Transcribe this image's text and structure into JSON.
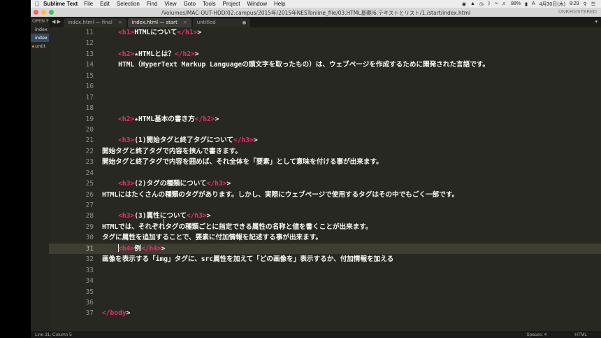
{
  "menubar": {
    "app": "Sublime Text",
    "items": [
      "File",
      "Edit",
      "Selection",
      "Find",
      "View",
      "Goto",
      "Tools",
      "Project",
      "Window",
      "Help"
    ],
    "battery": "88%",
    "date": "4月30日(木)",
    "time": "8:29"
  },
  "window": {
    "path": "/Volumes/MAC-OUT-HDD/02.campus/2015年/2015年NESTonline_file/03.HTML基礎/6.テキストとリスト/1./start/index.html",
    "unregistered": "UNREGISTERED"
  },
  "sidebar": {
    "header": "OPEN FILES",
    "files": [
      "index",
      "index",
      "untit"
    ]
  },
  "tabs": [
    {
      "label": "index.html — final"
    },
    {
      "label": "index.html — start"
    },
    {
      "label": "untitled"
    }
  ],
  "lines": [
    {
      "n": "11",
      "segs": [
        {
          "t": "    "
        },
        {
          "t": "<h1>",
          "c": "tag"
        },
        {
          "t": "HTMLについて"
        },
        {
          "t": "</h1>",
          "c": "tag"
        },
        {
          "t": ">"
        }
      ]
    },
    {
      "n": "12",
      "segs": []
    },
    {
      "n": "13",
      "segs": [
        {
          "t": "    "
        },
        {
          "t": "<h2>",
          "c": "tag"
        },
        {
          "t": "★HTMLとは？"
        },
        {
          "t": "</h2>",
          "c": "tag"
        },
        {
          "t": ">"
        }
      ]
    },
    {
      "n": "14",
      "segs": [
        {
          "t": "    HTML（HyperText Markup Languageの頭文字を取ったもの）は、ウェブページを作成するために開発された言語です。"
        }
      ]
    },
    {
      "n": "15",
      "segs": []
    },
    {
      "n": "16",
      "segs": []
    },
    {
      "n": "17",
      "segs": []
    },
    {
      "n": "18",
      "segs": []
    },
    {
      "n": "19",
      "segs": [
        {
          "t": "    "
        },
        {
          "t": "<h2>",
          "c": "tag"
        },
        {
          "t": "★HTML基本の書き方"
        },
        {
          "t": "</h2>",
          "c": "tag"
        },
        {
          "t": ">"
        }
      ]
    },
    {
      "n": "20",
      "segs": []
    },
    {
      "n": "21",
      "segs": [
        {
          "t": "    "
        },
        {
          "t": "<h3>",
          "c": "tag"
        },
        {
          "t": "(1)開始タグと終了タグについて"
        },
        {
          "t": "</h3>",
          "c": "tag"
        },
        {
          "t": ">"
        }
      ]
    },
    {
      "n": "22",
      "segs": [
        {
          "t": "開始タグと終了タグで内容を挟んで書きます。"
        }
      ]
    },
    {
      "n": "23",
      "segs": [
        {
          "t": "開始タグと終了タグで内容を囲めば、それ全体を「要素」として意味を付ける事が出来ます。"
        }
      ]
    },
    {
      "n": "24",
      "segs": []
    },
    {
      "n": "25",
      "segs": [
        {
          "t": "    "
        },
        {
          "t": "<h3>",
          "c": "tag"
        },
        {
          "t": "(2)タグの種類について"
        },
        {
          "t": "</h3>",
          "c": "tag"
        },
        {
          "t": ">"
        }
      ]
    },
    {
      "n": "26",
      "segs": [
        {
          "t": "HTMLにはたくさんの種類のタグがあります。しかし、実際にウェブページで使用するタグはその中でもごく一部です。"
        }
      ]
    },
    {
      "n": "27",
      "segs": []
    },
    {
      "n": "28",
      "segs": [
        {
          "t": "    "
        },
        {
          "t": "<h3>",
          "c": "tag"
        },
        {
          "t": "(3)属性について"
        },
        {
          "t": "</h3>",
          "c": "tag"
        },
        {
          "t": ">"
        }
      ]
    },
    {
      "n": "29",
      "segs": [
        {
          "t": "HTMLでは、それぞれタグの種類ごとに指定できる属性の名称と値を書くことが出来ます。"
        }
      ]
    },
    {
      "n": "30",
      "segs": [
        {
          "t": "タグに属性を追加することで、要素に付加情報を記述する事が出来ます。"
        }
      ]
    },
    {
      "n": "31",
      "current": true,
      "segs": [
        {
          "t": "    "
        },
        {
          "cursor": true
        },
        {
          "t": "<h4>",
          "c": "tag"
        },
        {
          "t": "例"
        },
        {
          "t": "</h4>",
          "c": "tag"
        },
        {
          "t": ">"
        }
      ]
    },
    {
      "n": "32",
      "segs": [
        {
          "t": "画像を表示する「img」タグに、src属性を加えて「どの画像を」表示するか、付加情報を加える"
        }
      ]
    },
    {
      "n": "33",
      "segs": []
    },
    {
      "n": "34",
      "segs": []
    },
    {
      "n": "35",
      "segs": []
    },
    {
      "n": "36",
      "segs": []
    },
    {
      "n": "37",
      "segs": [
        {
          "t": "</body",
          "c": "tag"
        },
        {
          "t": ">"
        }
      ]
    }
  ],
  "status": {
    "position": "Line 31, Column 5",
    "spaces": "Spaces: 4",
    "syntax": "HTML"
  }
}
